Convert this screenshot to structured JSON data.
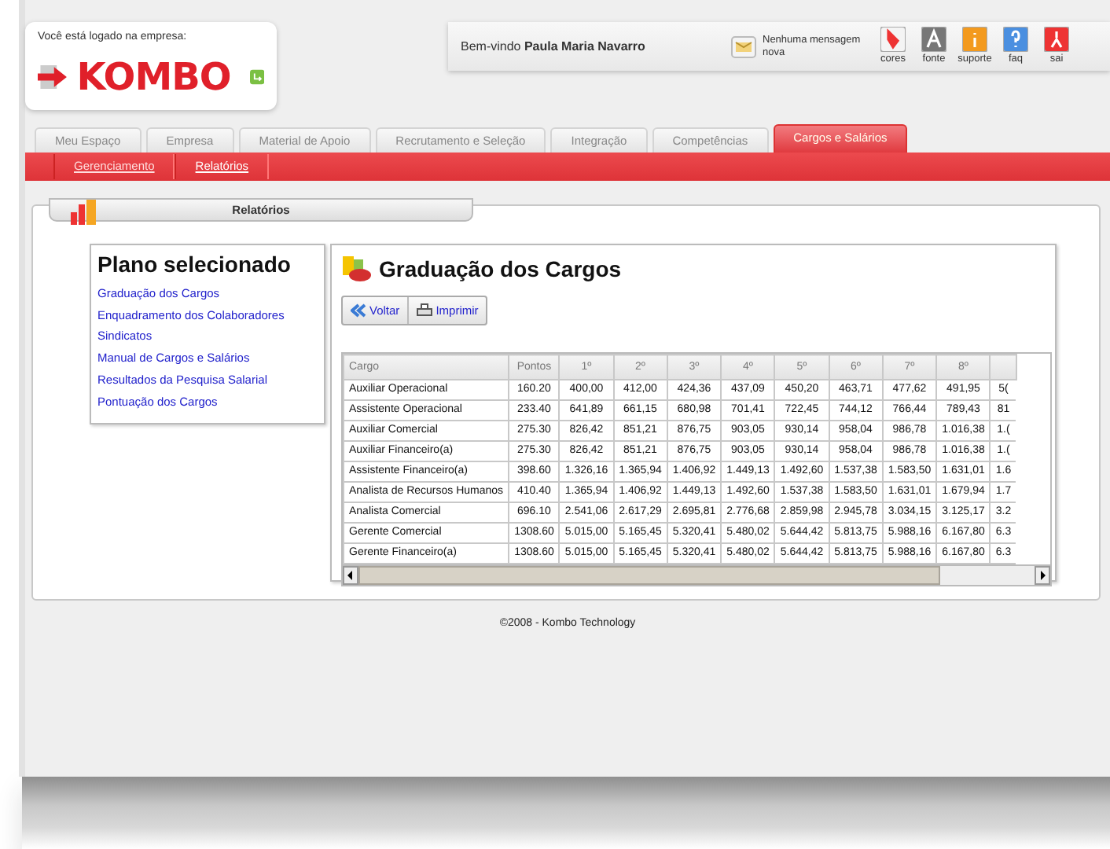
{
  "header": {
    "login_label": "Você está logado na empresa:",
    "logo": "KOMBO",
    "welcome": "Bem-vindo **Paula Maria Navarro**",
    "messages": "Nenhuma mensagem nova",
    "tools": [
      {
        "label": "cores",
        "kind": "palette"
      },
      {
        "label": "fonte",
        "kind": "font"
      },
      {
        "label": "suporte",
        "kind": "info"
      },
      {
        "label": "faq",
        "kind": "help"
      },
      {
        "label": "sai",
        "kind": "exit"
      }
    ]
  },
  "tabs": [
    {
      "label": "Meu Espaço",
      "selected": false
    },
    {
      "label": "Empresa",
      "selected": false
    },
    {
      "label": "Material de Apoio",
      "selected": false
    },
    {
      "label": "Recrutamento e Seleção",
      "selected": false
    },
    {
      "label": "Integração",
      "selected": false
    },
    {
      "label": "Competências",
      "selected": false
    },
    {
      "label": "Cargos e Salários",
      "selected": true
    }
  ],
  "subnav": [
    {
      "label": "Gerenciamento",
      "selected": false
    },
    {
      "label": "Relatórios",
      "selected": true
    }
  ],
  "panel_title": "Relatórios",
  "sidebar": {
    "title": "Plano selecionado",
    "items": [
      "Graduação dos Cargos",
      "Enquadramento dos Colaboradores",
      "Sindicatos",
      "Manual de Cargos e Salários",
      "Resultados da Pesquisa Salarial",
      "Pontuação dos Cargos"
    ]
  },
  "report": {
    "title": "Graduação dos Cargos",
    "buttons": [
      {
        "label": "Voltar",
        "kind": "back"
      },
      {
        "label": "Imprimir",
        "kind": "print"
      }
    ],
    "columns": [
      "Cargo",
      "Pontos",
      "1º",
      "2º",
      "3º",
      "4º",
      "5º",
      "6º",
      "7º",
      "8º"
    ],
    "rows": [
      [
        "Auxiliar Operacional",
        "160.20",
        "400,00",
        "412,00",
        "424,36",
        "437,09",
        "450,20",
        "463,71",
        "477,62",
        "491,95",
        "5("
      ],
      [
        "Assistente Operacional",
        "233.40",
        "641,89",
        "661,15",
        "680,98",
        "701,41",
        "722,45",
        "744,12",
        "766,44",
        "789,43",
        "81"
      ],
      [
        "Auxiliar Comercial",
        "275.30",
        "826,42",
        "851,21",
        "876,75",
        "903,05",
        "930,14",
        "958,04",
        "986,78",
        "1.016,38",
        "1.("
      ],
      [
        "Auxiliar Financeiro(a)",
        "275.30",
        "826,42",
        "851,21",
        "876,75",
        "903,05",
        "930,14",
        "958,04",
        "986,78",
        "1.016,38",
        "1.("
      ],
      [
        "Assistente Financeiro(a)",
        "398.60",
        "1.326,16",
        "1.365,94",
        "1.406,92",
        "1.449,13",
        "1.492,60",
        "1.537,38",
        "1.583,50",
        "1.631,01",
        "1.6"
      ],
      [
        "Analista de Recursos Humanos",
        "410.40",
        "1.365,94",
        "1.406,92",
        "1.449,13",
        "1.492,60",
        "1.537,38",
        "1.583,50",
        "1.631,01",
        "1.679,94",
        "1.7"
      ],
      [
        "Analista Comercial",
        "696.10",
        "2.541,06",
        "2.617,29",
        "2.695,81",
        "2.776,68",
        "2.859,98",
        "2.945,78",
        "3.034,15",
        "3.125,17",
        "3.2"
      ],
      [
        "Gerente Comercial",
        "1308.60",
        "5.015,00",
        "5.165,45",
        "5.320,41",
        "5.480,02",
        "5.644,42",
        "5.813,75",
        "5.988,16",
        "6.167,80",
        "6.3"
      ],
      [
        "Gerente Financeiro(a)",
        "1308.60",
        "5.015,00",
        "5.165,45",
        "5.320,41",
        "5.480,02",
        "5.644,42",
        "5.813,75",
        "5.988,16",
        "6.167,80",
        "6.3"
      ]
    ]
  },
  "footer": "©2008 - Kombo Technology"
}
